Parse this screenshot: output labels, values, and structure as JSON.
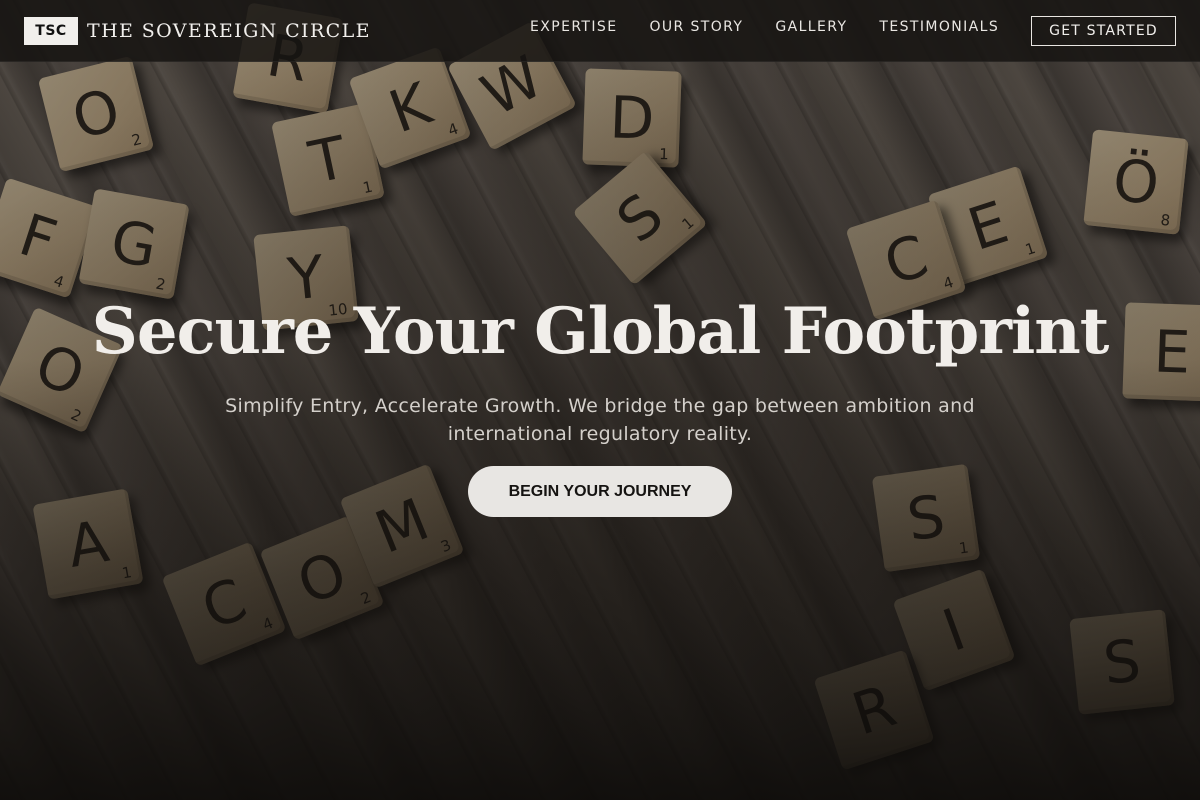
{
  "brand": {
    "mark": "TSC",
    "name": "THE SOVEREIGN CIRCLE"
  },
  "nav": {
    "links": [
      "EXPERTISE",
      "OUR STORY",
      "GALLERY",
      "TESTIMONIALS"
    ],
    "cta_label": "GET STARTED"
  },
  "hero": {
    "title": "Secure Your Global Footprint",
    "subtitle": "Simplify Entry, Accelerate Growth. We bridge the gap between ambition and international regulatory reality.",
    "cta_label": "BEGIN YOUR JOURNEY"
  },
  "background": {
    "tiles": [
      {
        "letter": "O",
        "points": "2"
      },
      {
        "letter": "R",
        "points": ""
      },
      {
        "letter": "T",
        "points": "1"
      },
      {
        "letter": "K",
        "points": "4"
      },
      {
        "letter": "W",
        "points": ""
      },
      {
        "letter": "D",
        "points": "1"
      },
      {
        "letter": "S",
        "points": "1"
      },
      {
        "letter": "Y",
        "points": "10"
      },
      {
        "letter": "F",
        "points": "4"
      },
      {
        "letter": "G",
        "points": "2"
      },
      {
        "letter": "O",
        "points": "2"
      },
      {
        "letter": "E",
        "points": "1"
      },
      {
        "letter": "C",
        "points": "4"
      },
      {
        "letter": "Ö",
        "points": "8"
      },
      {
        "letter": "E",
        "points": ""
      },
      {
        "letter": "A",
        "points": "1"
      },
      {
        "letter": "C",
        "points": "4"
      },
      {
        "letter": "O",
        "points": "2"
      },
      {
        "letter": "M",
        "points": "3"
      },
      {
        "letter": "S",
        "points": "1"
      },
      {
        "letter": "I",
        "points": ""
      },
      {
        "letter": "R",
        "points": ""
      },
      {
        "letter": "S",
        "points": ""
      }
    ]
  },
  "colors": {
    "nav_bg": "#161412",
    "text_light": "#f1eeea",
    "cta_bg": "#e8e6e3",
    "tile": "#d2bf9d"
  }
}
